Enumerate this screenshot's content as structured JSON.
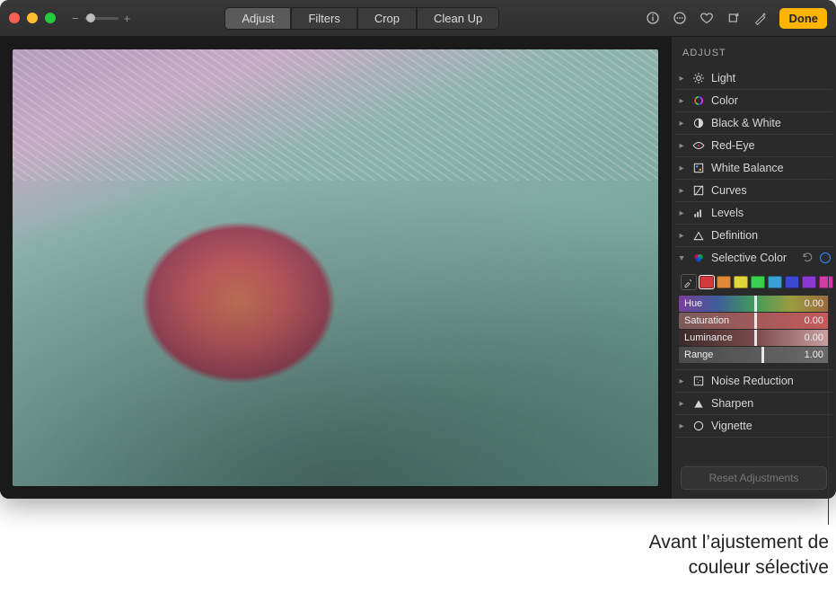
{
  "titlebar": {
    "tabs": [
      {
        "label": "Adjust",
        "active": true
      },
      {
        "label": "Filters",
        "active": false
      },
      {
        "label": "Crop",
        "active": false
      },
      {
        "label": "Clean Up",
        "active": false
      }
    ],
    "done_label": "Done"
  },
  "sidebar": {
    "title": "ADJUST",
    "items": [
      {
        "label": "Light",
        "icon": "sun"
      },
      {
        "label": "Color",
        "icon": "hue-ring"
      },
      {
        "label": "Black & White",
        "icon": "contrast"
      },
      {
        "label": "Red-Eye",
        "icon": "eye"
      },
      {
        "label": "White Balance",
        "icon": "dropper-grid"
      },
      {
        "label": "Curves",
        "icon": "curves"
      },
      {
        "label": "Levels",
        "icon": "levels"
      },
      {
        "label": "Definition",
        "icon": "triangle"
      }
    ],
    "selective_color": {
      "label": "Selective Color",
      "swatches": [
        "#d23a3a",
        "#e0873a",
        "#e0d53a",
        "#3ad24c",
        "#3a9fd2",
        "#3a49d2",
        "#8a3ad2",
        "#d23aa6"
      ],
      "selected_swatch_index": 0,
      "sliders": [
        {
          "name": "Hue",
          "value": "0.00",
          "pos": 50,
          "class": "sl-hue"
        },
        {
          "name": "Saturation",
          "value": "0.00",
          "pos": 50,
          "class": "sl-sat"
        },
        {
          "name": "Luminance",
          "value": "0.00",
          "pos": 50,
          "class": "sl-lum"
        },
        {
          "name": "Range",
          "value": "1.00",
          "pos": 55,
          "class": "sl-rng"
        }
      ]
    },
    "items_after": [
      {
        "label": "Noise Reduction",
        "icon": "noise"
      },
      {
        "label": "Sharpen",
        "icon": "triangle-solid"
      },
      {
        "label": "Vignette",
        "icon": "circle"
      }
    ],
    "reset_label": "Reset Adjustments"
  },
  "caption": {
    "line1": "Avant l’ajustement de",
    "line2": "couleur sélective"
  }
}
